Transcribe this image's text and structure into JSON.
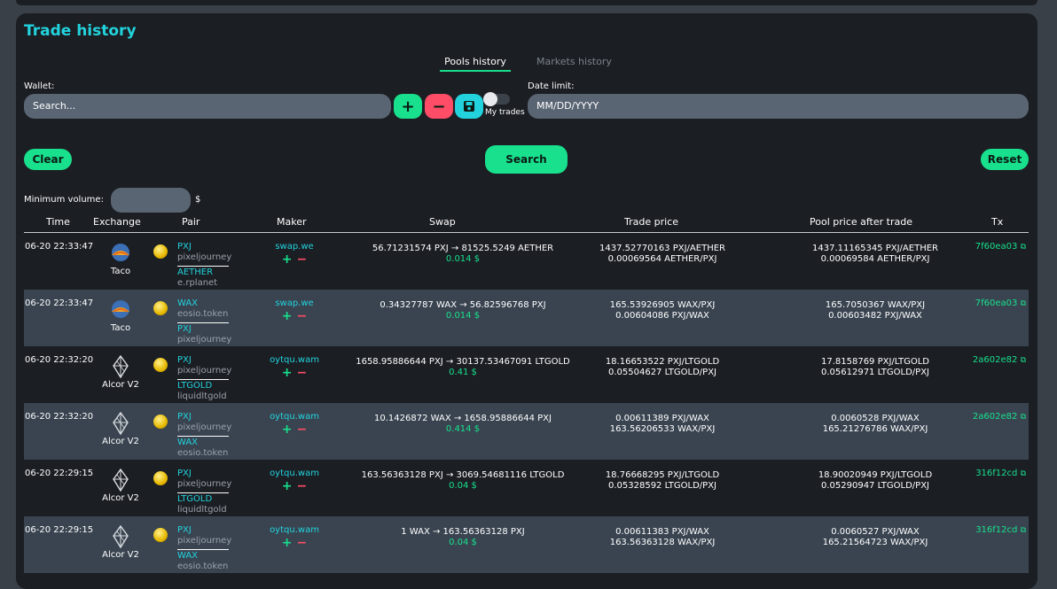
{
  "title": "Trade history",
  "tabs": [
    {
      "label": "Pools history",
      "active": true
    },
    {
      "label": "Markets history",
      "active": false
    }
  ],
  "filters": {
    "wallet_label": "Wallet:",
    "wallet_placeholder": "Search...",
    "add_symbol": "+",
    "remove_symbol": "−",
    "my_trades_label": "My trades",
    "date_label": "Date limit:",
    "date_placeholder": "MM/DD/YYYY",
    "clear_label": "Clear",
    "search_label": "Search",
    "reset_label": "Reset",
    "min_volume_label": "Minimum volume:",
    "min_volume_unit": "$"
  },
  "colors": {
    "accent": "#22d3dd",
    "green": "#18e08d",
    "red": "#ff4d67"
  },
  "columns": [
    "Time",
    "Exchange",
    "Pair",
    "Maker",
    "Swap",
    "Trade price",
    "Pool price after trade",
    "Tx"
  ],
  "rows": [
    {
      "time": "06-20 22:33:47",
      "exchange": "Taco",
      "exchange_icon": "taco-icon",
      "pair": {
        "token1": "PXJ",
        "contract1": "pixeljourney",
        "token2": "AETHER",
        "contract2": "e.rplanet"
      },
      "maker": "swap.we",
      "swap": "56.71231574 PXJ → 81525.5249 AETHER",
      "usd": "0.014 $",
      "trade_price": [
        "1437.52770163 PXJ/AETHER",
        "0.00069564 AETHER/PXJ"
      ],
      "pool_price": [
        "1437.11165345 PXJ/AETHER",
        "0.00069584 AETHER/PXJ"
      ],
      "tx": "7f60ea03"
    },
    {
      "time": "06-20 22:33:47",
      "exchange": "Taco",
      "exchange_icon": "taco-icon",
      "pair": {
        "token1": "WAX",
        "contract1": "eosio.token",
        "token2": "PXJ",
        "contract2": "pixeljourney"
      },
      "maker": "swap.we",
      "swap": "0.34327787 WAX → 56.82596768 PXJ",
      "usd": "0.014 $",
      "trade_price": [
        "165.53926905 WAX/PXJ",
        "0.00604086 PXJ/WAX"
      ],
      "pool_price": [
        "165.7050367 WAX/PXJ",
        "0.00603482 PXJ/WAX"
      ],
      "tx": "7f60ea03"
    },
    {
      "time": "06-20 22:32:20",
      "exchange": "Alcor V2",
      "exchange_icon": "alcor-icon",
      "pair": {
        "token1": "PXJ",
        "contract1": "pixeljourney",
        "token2": "LTGOLD",
        "contract2": "liquidltgold"
      },
      "maker": "oytqu.wam",
      "swap": "1658.95886644 PXJ → 30137.53467091 LTGOLD",
      "usd": "0.41 $",
      "trade_price": [
        "18.16653522 PXJ/LTGOLD",
        "0.05504627 LTGOLD/PXJ"
      ],
      "pool_price": [
        "17.8158769 PXJ/LTGOLD",
        "0.05612971 LTGOLD/PXJ"
      ],
      "tx": "2a602e82"
    },
    {
      "time": "06-20 22:32:20",
      "exchange": "Alcor V2",
      "exchange_icon": "alcor-icon",
      "pair": {
        "token1": "PXJ",
        "contract1": "pixeljourney",
        "token2": "WAX",
        "contract2": "eosio.token"
      },
      "maker": "oytqu.wam",
      "swap": "10.1426872 WAX → 1658.95886644 PXJ",
      "usd": "0.414 $",
      "trade_price": [
        "0.00611389 PXJ/WAX",
        "163.56206533 WAX/PXJ"
      ],
      "pool_price": [
        "0.0060528 PXJ/WAX",
        "165.21276786 WAX/PXJ"
      ],
      "tx": "2a602e82"
    },
    {
      "time": "06-20 22:29:15",
      "exchange": "Alcor V2",
      "exchange_icon": "alcor-icon",
      "pair": {
        "token1": "PXJ",
        "contract1": "pixeljourney",
        "token2": "LTGOLD",
        "contract2": "liquidltgold"
      },
      "maker": "oytqu.wam",
      "swap": "163.56363128 PXJ → 3069.54681116 LTGOLD",
      "usd": "0.04 $",
      "trade_price": [
        "18.76668295 PXJ/LTGOLD",
        "0.05328592 LTGOLD/PXJ"
      ],
      "pool_price": [
        "18.90020949 PXJ/LTGOLD",
        "0.05290947 LTGOLD/PXJ"
      ],
      "tx": "316f12cd"
    },
    {
      "time": "06-20 22:29:15",
      "exchange": "Alcor V2",
      "exchange_icon": "alcor-icon",
      "pair": {
        "token1": "PXJ",
        "contract1": "pixeljourney",
        "token2": "WAX",
        "contract2": "eosio.token"
      },
      "maker": "oytqu.wam",
      "swap": "1 WAX → 163.56363128 PXJ",
      "usd": "0.04 $",
      "trade_price": [
        "0.00611383 PXJ/WAX",
        "163.56363128 WAX/PXJ"
      ],
      "pool_price": [
        "0.0060527 PXJ/WAX",
        "165.21564723 WAX/PXJ"
      ],
      "tx": "316f12cd"
    }
  ]
}
